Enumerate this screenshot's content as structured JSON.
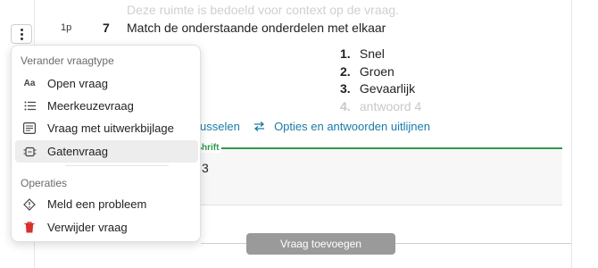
{
  "question": {
    "context_hint": "Deze ruimte is bedoeld voor context op de vraag.",
    "points": "1p",
    "number": "7",
    "text": "Match de onderstaande onderdelen met elkaar"
  },
  "answers": [
    {
      "num": "1.",
      "label": "Snel"
    },
    {
      "num": "2.",
      "label": "Groen"
    },
    {
      "num": "3.",
      "label": "Gevaarlijk"
    },
    {
      "num": "4.",
      "label": "antwoord 4"
    }
  ],
  "toolbar": {
    "shuffle_label": "usselen",
    "align_label": "Opties en antwoorden uitlijnen"
  },
  "answer_box": {
    "label_fragment": "hrift",
    "value": "3"
  },
  "add_question_label": "Vraag toevoegen",
  "menu": {
    "type_section": "Verander vraagtype",
    "type_items": [
      "Open vraag",
      "Meerkeuzevraag",
      "Vraag met uitwerkbijlage",
      "Gatenvraag"
    ],
    "type_icons": [
      "text-type-icon",
      "list-icon",
      "attachment-sheet-icon",
      "fill-gap-icon"
    ],
    "active_item": "Gatenvraag",
    "ops_section": "Operaties",
    "op_items": [
      "Meld een probleem",
      "Verwijder vraag"
    ],
    "op_icons": [
      "warning-diamond-icon",
      "trash-icon"
    ],
    "aa_glyph": "Aa"
  },
  "colors": {
    "link": "#1a7ba8",
    "green": "#2e9a4a",
    "danger": "#d9302c",
    "button": "#9a9a9a"
  }
}
